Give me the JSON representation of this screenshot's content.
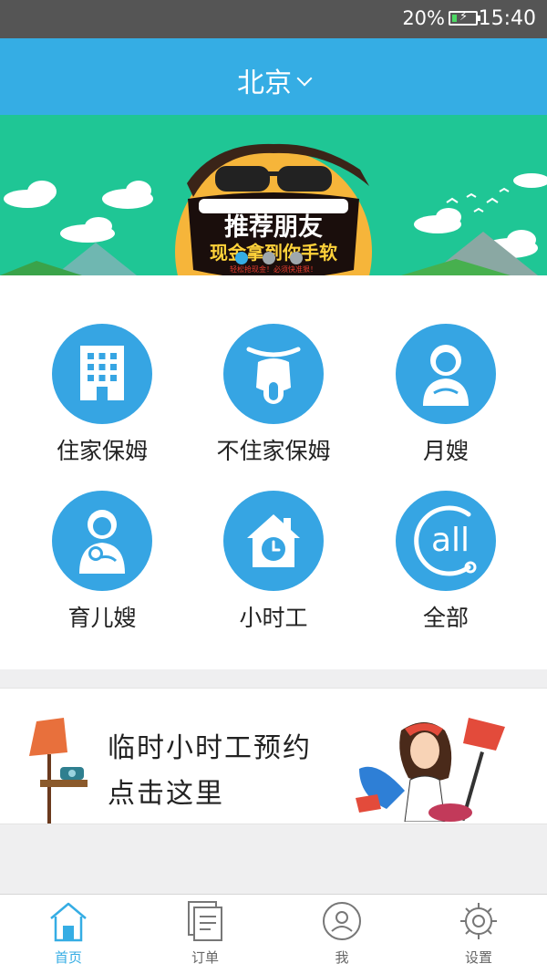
{
  "status_bar": {
    "battery": "20%",
    "time": "15:40"
  },
  "header": {
    "city": "北京"
  },
  "banner": {
    "title": "推荐朋友",
    "subtitle": "现金拿到你手软",
    "small_text": "轻松抢现金！必须快准狠！",
    "slides": 3,
    "active_slide": 0
  },
  "services": [
    {
      "label": "住家保姆",
      "icon": "building-icon"
    },
    {
      "label": "不住家保姆",
      "icon": "scooter-icon"
    },
    {
      "label": "月嫂",
      "icon": "nanny-icon"
    },
    {
      "label": "育儿嫂",
      "icon": "mother-baby-icon"
    },
    {
      "label": "小时工",
      "icon": "house-clock-icon"
    },
    {
      "label": "全部",
      "icon": "call-all-icon"
    }
  ],
  "promo": {
    "line1": "临时小时工预约",
    "line2": "点击这里"
  },
  "tabbar": [
    {
      "label": "首页",
      "icon": "home-icon",
      "active": true
    },
    {
      "label": "订单",
      "icon": "orders-icon",
      "active": false
    },
    {
      "label": "我",
      "icon": "profile-icon",
      "active": false
    },
    {
      "label": "设置",
      "icon": "settings-icon",
      "active": false
    }
  ],
  "colors": {
    "primary": "#35ade4",
    "icon_circle": "#36a5e3",
    "banner_bg": "#1fc695"
  }
}
